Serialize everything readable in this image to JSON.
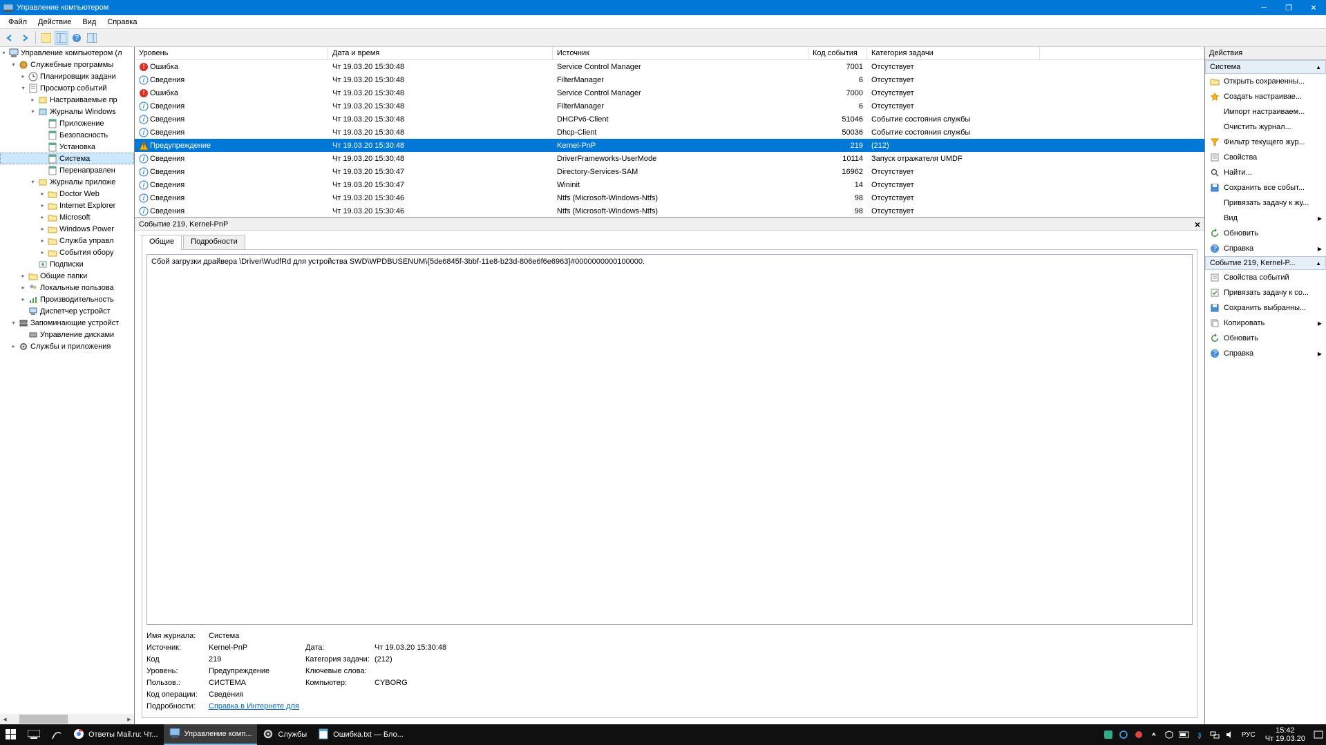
{
  "title": "Управление компьютером",
  "menu": [
    "Файл",
    "Действие",
    "Вид",
    "Справка"
  ],
  "tree": [
    {
      "level": 0,
      "exp": "▾",
      "icon": "computer",
      "label": "Управление компьютером (л"
    },
    {
      "level": 1,
      "exp": "▾",
      "icon": "tools",
      "label": "Служебные программы"
    },
    {
      "level": 2,
      "exp": "▸",
      "icon": "scheduler",
      "label": "Планировщик задани"
    },
    {
      "level": 2,
      "exp": "▾",
      "icon": "eventvwr",
      "label": "Просмотр событий"
    },
    {
      "level": 3,
      "exp": "▸",
      "icon": "customview",
      "label": "Настраиваемые пр"
    },
    {
      "level": 3,
      "exp": "▾",
      "icon": "winlog",
      "label": "Журналы Windows"
    },
    {
      "level": 4,
      "exp": "",
      "icon": "log",
      "label": "Приложение"
    },
    {
      "level": 4,
      "exp": "",
      "icon": "log",
      "label": "Безопасность"
    },
    {
      "level": 4,
      "exp": "",
      "icon": "log",
      "label": "Установка"
    },
    {
      "level": 4,
      "exp": "",
      "icon": "log",
      "label": "Система",
      "selected": true
    },
    {
      "level": 4,
      "exp": "",
      "icon": "log",
      "label": "Перенаправлен"
    },
    {
      "level": 3,
      "exp": "▾",
      "icon": "applog",
      "label": "Журналы приложе"
    },
    {
      "level": 4,
      "exp": "▸",
      "icon": "folder",
      "label": "Doctor Web"
    },
    {
      "level": 4,
      "exp": "▸",
      "icon": "folder",
      "label": "Internet Explorer"
    },
    {
      "level": 4,
      "exp": "▸",
      "icon": "folder",
      "label": "Microsoft"
    },
    {
      "level": 4,
      "exp": "▸",
      "icon": "folder",
      "label": "Windows Power"
    },
    {
      "level": 4,
      "exp": "▸",
      "icon": "folder",
      "label": "Служба управл"
    },
    {
      "level": 4,
      "exp": "▸",
      "icon": "folder",
      "label": "События обору"
    },
    {
      "level": 3,
      "exp": "",
      "icon": "subs",
      "label": "Подписки"
    },
    {
      "level": 2,
      "exp": "▸",
      "icon": "shared",
      "label": "Общие папки"
    },
    {
      "level": 2,
      "exp": "▸",
      "icon": "users",
      "label": "Локальные пользова"
    },
    {
      "level": 2,
      "exp": "▸",
      "icon": "perf",
      "label": "Производительность"
    },
    {
      "level": 2,
      "exp": "",
      "icon": "devmgr",
      "label": "Диспетчер устройст"
    },
    {
      "level": 1,
      "exp": "▾",
      "icon": "storage",
      "label": "Запоминающие устройст"
    },
    {
      "level": 2,
      "exp": "",
      "icon": "diskmgr",
      "label": "Управление дисками"
    },
    {
      "level": 1,
      "exp": "▸",
      "icon": "services",
      "label": "Службы и приложения"
    }
  ],
  "columns": [
    "Уровень",
    "Дата и время",
    "Источник",
    "Код события",
    "Категория задачи"
  ],
  "events": [
    {
      "lvl": "error",
      "level": "Ошибка",
      "date": "Чт 19.03.20 15:30:48",
      "src": "Service Control Manager",
      "code": "7001",
      "cat": "Отсутствует"
    },
    {
      "lvl": "info",
      "level": "Сведения",
      "date": "Чт 19.03.20 15:30:48",
      "src": "FilterManager",
      "code": "6",
      "cat": "Отсутствует"
    },
    {
      "lvl": "error",
      "level": "Ошибка",
      "date": "Чт 19.03.20 15:30:48",
      "src": "Service Control Manager",
      "code": "7000",
      "cat": "Отсутствует"
    },
    {
      "lvl": "info",
      "level": "Сведения",
      "date": "Чт 19.03.20 15:30:48",
      "src": "FilterManager",
      "code": "6",
      "cat": "Отсутствует"
    },
    {
      "lvl": "info",
      "level": "Сведения",
      "date": "Чт 19.03.20 15:30:48",
      "src": "DHCPv6-Client",
      "code": "51046",
      "cat": "Событие состояния службы"
    },
    {
      "lvl": "info",
      "level": "Сведения",
      "date": "Чт 19.03.20 15:30:48",
      "src": "Dhcp-Client",
      "code": "50036",
      "cat": "Событие состояния службы"
    },
    {
      "lvl": "warn",
      "level": "Предупреждение",
      "date": "Чт 19.03.20 15:30:48",
      "src": "Kernel-PnP",
      "code": "219",
      "cat": "(212)",
      "selected": true
    },
    {
      "lvl": "info",
      "level": "Сведения",
      "date": "Чт 19.03.20 15:30:48",
      "src": "DriverFrameworks-UserMode",
      "code": "10114",
      "cat": "Запуск отражателя UMDF"
    },
    {
      "lvl": "info",
      "level": "Сведения",
      "date": "Чт 19.03.20 15:30:47",
      "src": "Directory-Services-SAM",
      "code": "16962",
      "cat": "Отсутствует"
    },
    {
      "lvl": "info",
      "level": "Сведения",
      "date": "Чт 19.03.20 15:30:47",
      "src": "Wininit",
      "code": "14",
      "cat": "Отсутствует"
    },
    {
      "lvl": "info",
      "level": "Сведения",
      "date": "Чт 19.03.20 15:30:46",
      "src": "Ntfs (Microsoft-Windows-Ntfs)",
      "code": "98",
      "cat": "Отсутствует"
    },
    {
      "lvl": "info",
      "level": "Сведения",
      "date": "Чт 19.03.20 15:30:46",
      "src": "Ntfs (Microsoft-Windows-Ntfs)",
      "code": "98",
      "cat": "Отсутствует"
    }
  ],
  "preview": {
    "header": "Событие 219, Kernel-PnP",
    "tabs": [
      "Общие",
      "Подробности"
    ],
    "description": "Сбой загрузки драйвера \\Driver\\WudfRd для устройства SWD\\WPDBUSENUM\\{5de6845f-3bbf-11e8-b23d-806e6f6e6963}#0000000000100000.",
    "fields": {
      "log_name_lbl": "Имя журнала:",
      "log_name": "Система",
      "src_lbl": "Источник:",
      "src": "Kernel-PnP",
      "date_lbl": "Дата:",
      "date": "Чт 19.03.20 15:30:48",
      "code_lbl": "Код",
      "code": "219",
      "cat_lbl": "Категория задачи:",
      "cat": "(212)",
      "level_lbl": "Уровень:",
      "level": "Предупреждение",
      "kw_lbl": "Ключевые слова:",
      "kw": "",
      "user_lbl": "Пользов.:",
      "user": "СИСТЕМА",
      "comp_lbl": "Компьютер:",
      "comp": "CYBORG",
      "op_lbl": "Код операции:",
      "op": "Сведения",
      "more_lbl": "Подробности:",
      "more_link": "Справка в Интернете для "
    }
  },
  "actions": {
    "header": "Действия",
    "group1": "Система",
    "group2": "Событие 219, Kernel-P...",
    "g1": [
      {
        "icon": "open",
        "label": "Открыть сохраненны..."
      },
      {
        "icon": "new",
        "label": "Создать настраивае..."
      },
      {
        "icon": "",
        "label": "Импорт настраиваем..."
      },
      {
        "icon": "",
        "label": "Очистить журнал..."
      },
      {
        "icon": "filter",
        "label": "Фильтр текущего жур..."
      },
      {
        "icon": "props",
        "label": "Свойства"
      },
      {
        "icon": "find",
        "label": "Найти..."
      },
      {
        "icon": "save",
        "label": "Сохранить все событ..."
      },
      {
        "icon": "",
        "label": "Привязать задачу к жу..."
      },
      {
        "icon": "",
        "label": "Вид",
        "arrow": true
      },
      {
        "icon": "refresh",
        "label": "Обновить"
      },
      {
        "icon": "help",
        "label": "Справка",
        "arrow": true
      }
    ],
    "g2": [
      {
        "icon": "props",
        "label": "Свойства событий"
      },
      {
        "icon": "task",
        "label": "Привязать задачу к со..."
      },
      {
        "icon": "save",
        "label": "Сохранить выбранны..."
      },
      {
        "icon": "copy",
        "label": "Копировать",
        "arrow": true
      },
      {
        "icon": "refresh",
        "label": "Обновить"
      },
      {
        "icon": "help",
        "label": "Справка",
        "arrow": true
      }
    ]
  },
  "taskbar": {
    "items": [
      {
        "icon": "chrome",
        "label": "Ответы Mail.ru: Чт..."
      },
      {
        "icon": "compmgmt",
        "label": "Управление комп...",
        "active": true
      },
      {
        "icon": "services",
        "label": "Службы"
      },
      {
        "icon": "notepad",
        "label": "Ошибка.txt — Бло..."
      }
    ],
    "lang": "РУС",
    "time": "15:42",
    "date": "Чт 19.03.20"
  }
}
